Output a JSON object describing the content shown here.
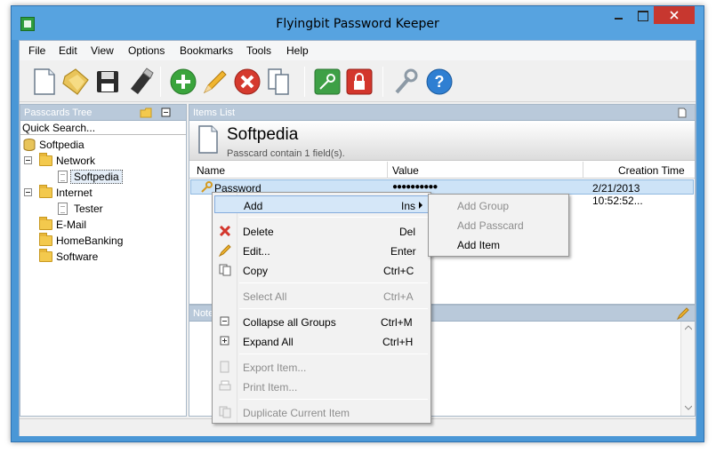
{
  "window": {
    "title": "Flyingbit Password Keeper"
  },
  "menu": [
    "File",
    "Edit",
    "View",
    "Options",
    "Bookmarks",
    "Tools",
    "Help"
  ],
  "toolbar": {
    "icons": [
      "new-file-icon",
      "open-folder-icon",
      "save-icon",
      "usb-drive-icon",
      "add-icon",
      "edit-pencil-icon",
      "delete-icon",
      "copy-icon",
      "key-icon",
      "lock-icon",
      "tools-wrench-icon",
      "help-icon"
    ]
  },
  "left": {
    "header": "Passcards Tree",
    "quick_search": "Quick Search...",
    "tree": {
      "root": "Softpedia",
      "network": "Network",
      "network_child": "Softpedia",
      "internet": "Internet",
      "internet_child": "Tester",
      "email": "E-Mail",
      "homebanking": "HomeBanking",
      "software": "Software"
    }
  },
  "items": {
    "header": "Items List",
    "passcard_title": "Softpedia",
    "passcard_sub": "Passcard contain 1 field(s).",
    "columns": {
      "name": "Name",
      "value": "Value",
      "creation_time": "Creation Time"
    },
    "row": {
      "name": "Password",
      "value": "●●●●●●●●●●",
      "creation_time": "2/21/2013 10:52:52..."
    }
  },
  "note": {
    "header": "Note"
  },
  "context_menu": {
    "add": {
      "label": "Add",
      "shortcut": "Ins"
    },
    "delete": {
      "label": "Delete",
      "shortcut": "Del"
    },
    "edit": {
      "label": "Edit...",
      "shortcut": "Enter"
    },
    "copy": {
      "label": "Copy",
      "shortcut": "Ctrl+C"
    },
    "select_all": {
      "label": "Select All",
      "shortcut": "Ctrl+A"
    },
    "collapse": {
      "label": "Collapse all Groups",
      "shortcut": "Ctrl+M"
    },
    "expand": {
      "label": "Expand All",
      "shortcut": "Ctrl+H"
    },
    "export": {
      "label": "Export Item..."
    },
    "print": {
      "label": "Print Item..."
    },
    "duplicate": {
      "label": "Duplicate Current Item"
    }
  },
  "submenu": {
    "add_group": "Add Group",
    "add_passcard": "Add Passcard",
    "add_item": "Add Item"
  },
  "colors": {
    "titlebar": "#57a3e0",
    "close": "#c7372f",
    "highlight": "#d5e7f8",
    "panel_header": "#b9c9da"
  }
}
